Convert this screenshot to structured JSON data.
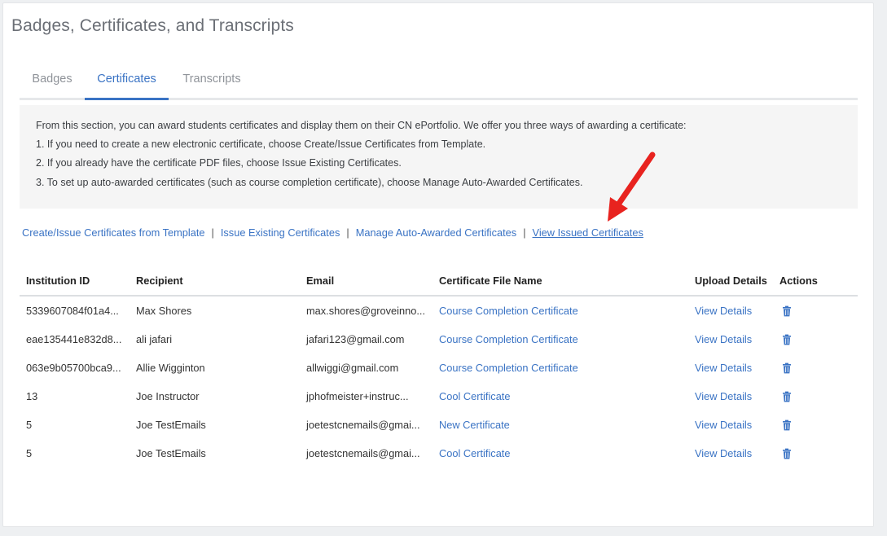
{
  "page": {
    "title": "Badges, Certificates, and Transcripts"
  },
  "tabs": [
    {
      "label": "Badges",
      "active": false
    },
    {
      "label": "Certificates",
      "active": true
    },
    {
      "label": "Transcripts",
      "active": false
    }
  ],
  "info": {
    "lines": [
      "From this section, you can award students certificates and display them on their CN ePortfolio. We offer you three ways of awarding a certificate:",
      "1. If you need to create a new electronic certificate, choose Create/Issue Certificates from Template.",
      "2. If you already have the certificate PDF files, choose Issue Existing Certificates.",
      "3. To set up auto-awarded certificates (such as course completion certificate), choose Manage Auto-Awarded Certificates."
    ]
  },
  "links": {
    "create": "Create/Issue Certificates from Template",
    "issue": "Issue Existing Certificates",
    "manage": "Manage Auto-Awarded Certificates",
    "view": "View Issued Certificates",
    "separator": "|"
  },
  "table": {
    "headers": [
      "Institution ID",
      "Recipient",
      "Email",
      "Certificate File Name",
      "Upload Details",
      "Actions"
    ],
    "rows": [
      {
        "id": "5339607084f01a4...",
        "recipient": "Max Shores",
        "email": "max.shores@groveinno...",
        "file": "Course Completion Certificate",
        "details": "View Details"
      },
      {
        "id": "eae135441e832d8...",
        "recipient": "ali jafari",
        "email": "jafari123@gmail.com",
        "file": "Course Completion Certificate",
        "details": "View Details"
      },
      {
        "id": "063e9b05700bca9...",
        "recipient": "Allie Wigginton",
        "email": "allwiggi@gmail.com",
        "file": "Course Completion Certificate",
        "details": "View Details"
      },
      {
        "id": "13",
        "recipient": "Joe Instructor",
        "email": "jphofmeister+instruc...",
        "file": "Cool Certificate",
        "details": "View Details"
      },
      {
        "id": "5",
        "recipient": "Joe TestEmails",
        "email": "joetestcnemails@gmai...",
        "file": "New Certificate",
        "details": "View Details"
      },
      {
        "id": "5",
        "recipient": "Joe TestEmails",
        "email": "joetestcnemails@gmai...",
        "file": "Cool Certificate",
        "details": "View Details"
      }
    ]
  },
  "icons": {
    "delete": "trash-icon",
    "annotation": "red-arrow-annotation"
  },
  "colors": {
    "accent": "#3a73c4",
    "arrow": "#e8231f"
  }
}
